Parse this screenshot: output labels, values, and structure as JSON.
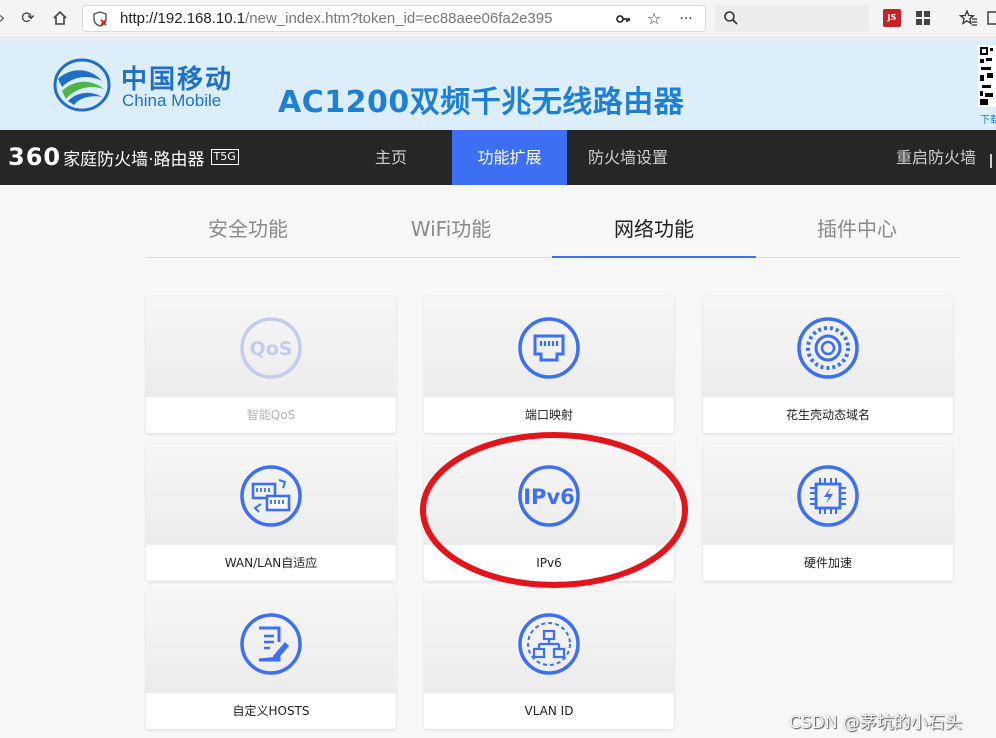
{
  "browser": {
    "url_host": "http://192.168.10.1",
    "url_path": "/new_index.htm?token_id=ec88aee06fa2e395",
    "search_placeholder": "",
    "ext_label": "JS"
  },
  "banner": {
    "brand_cn": "中国移动",
    "brand_en": "China Mobile",
    "product_title": "AC1200双频千兆无线路由器",
    "qr_caption": "下载"
  },
  "router_nav": {
    "brand_prefix": "360",
    "brand_text": "家庭防火墙·路由器",
    "model": "T5G",
    "items": [
      {
        "label": "主页"
      },
      {
        "label": "功能扩展"
      },
      {
        "label": "防火墙设置"
      }
    ],
    "reboot_label": "重启防火墙"
  },
  "sub_tabs": [
    {
      "label": "安全功能"
    },
    {
      "label": "WiFi功能"
    },
    {
      "label": "网络功能"
    },
    {
      "label": "插件中心"
    }
  ],
  "cards": [
    {
      "label": "智能QoS",
      "icon": "qos-icon",
      "icon_text": "QoS"
    },
    {
      "label": "端口映射",
      "icon": "port-mapping-icon"
    },
    {
      "label": "花生壳动态域名",
      "icon": "ddns-icon"
    },
    {
      "label": "WAN/LAN自适应",
      "icon": "wan-lan-icon"
    },
    {
      "label": "IPv6",
      "icon": "ipv6-icon",
      "icon_text": "IPv6"
    },
    {
      "label": "硬件加速",
      "icon": "hardware-accel-icon"
    },
    {
      "label": "自定义HOSTS",
      "icon": "hosts-icon"
    },
    {
      "label": "VLAN ID",
      "icon": "vlan-icon"
    }
  ],
  "watermark": "CSDN @茅坑的小石头",
  "colors": {
    "accent": "#3d6ff5",
    "nav_bg": "#262626",
    "banner_bg": "#ddeefb",
    "highlight": "#e4141b"
  }
}
